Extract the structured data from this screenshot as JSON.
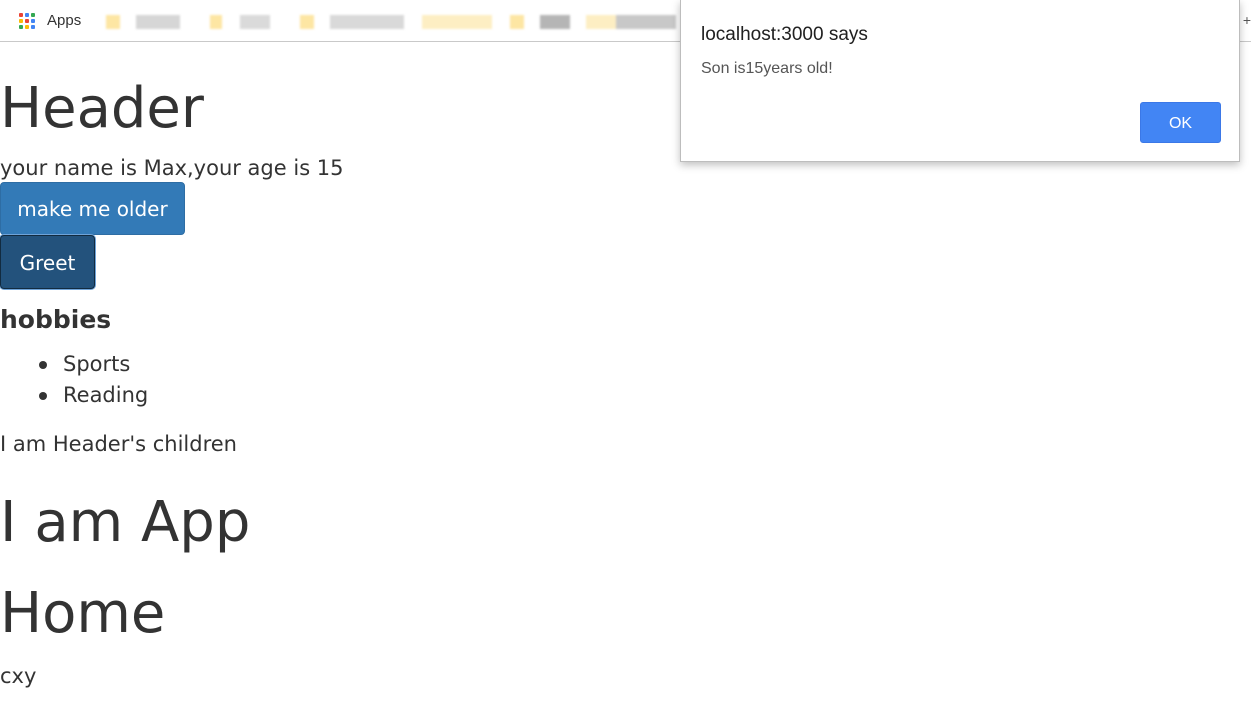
{
  "bookmarks_bar": {
    "apps_label": "Apps",
    "plus_glyph": "+",
    "apps_icon_colors": [
      "#ea4335",
      "#4285f4",
      "#34a853",
      "#fbbc05",
      "#ea4335",
      "#4285f4",
      "#34a853",
      "#fbbc05",
      "#4285f4"
    ]
  },
  "page": {
    "header_title": "Header",
    "name_age_text": "your name is Max,your age is 15",
    "make_older_label": "make me older",
    "greet_label": "Greet",
    "hobbies_heading": "hobbies",
    "hobbies": [
      "Sports",
      "Reading"
    ],
    "children_text": "I am Header's children",
    "app_heading": "I am App",
    "home_heading": "Home",
    "footer_text": "cxy"
  },
  "alert": {
    "title": "localhost:3000 says",
    "message": "Son is15years old!",
    "ok_label": "OK"
  },
  "colors": {
    "primary_button": "#337ab7",
    "greet_button_active": "#23527c",
    "alert_ok": "#4285f4",
    "text": "#333333"
  }
}
